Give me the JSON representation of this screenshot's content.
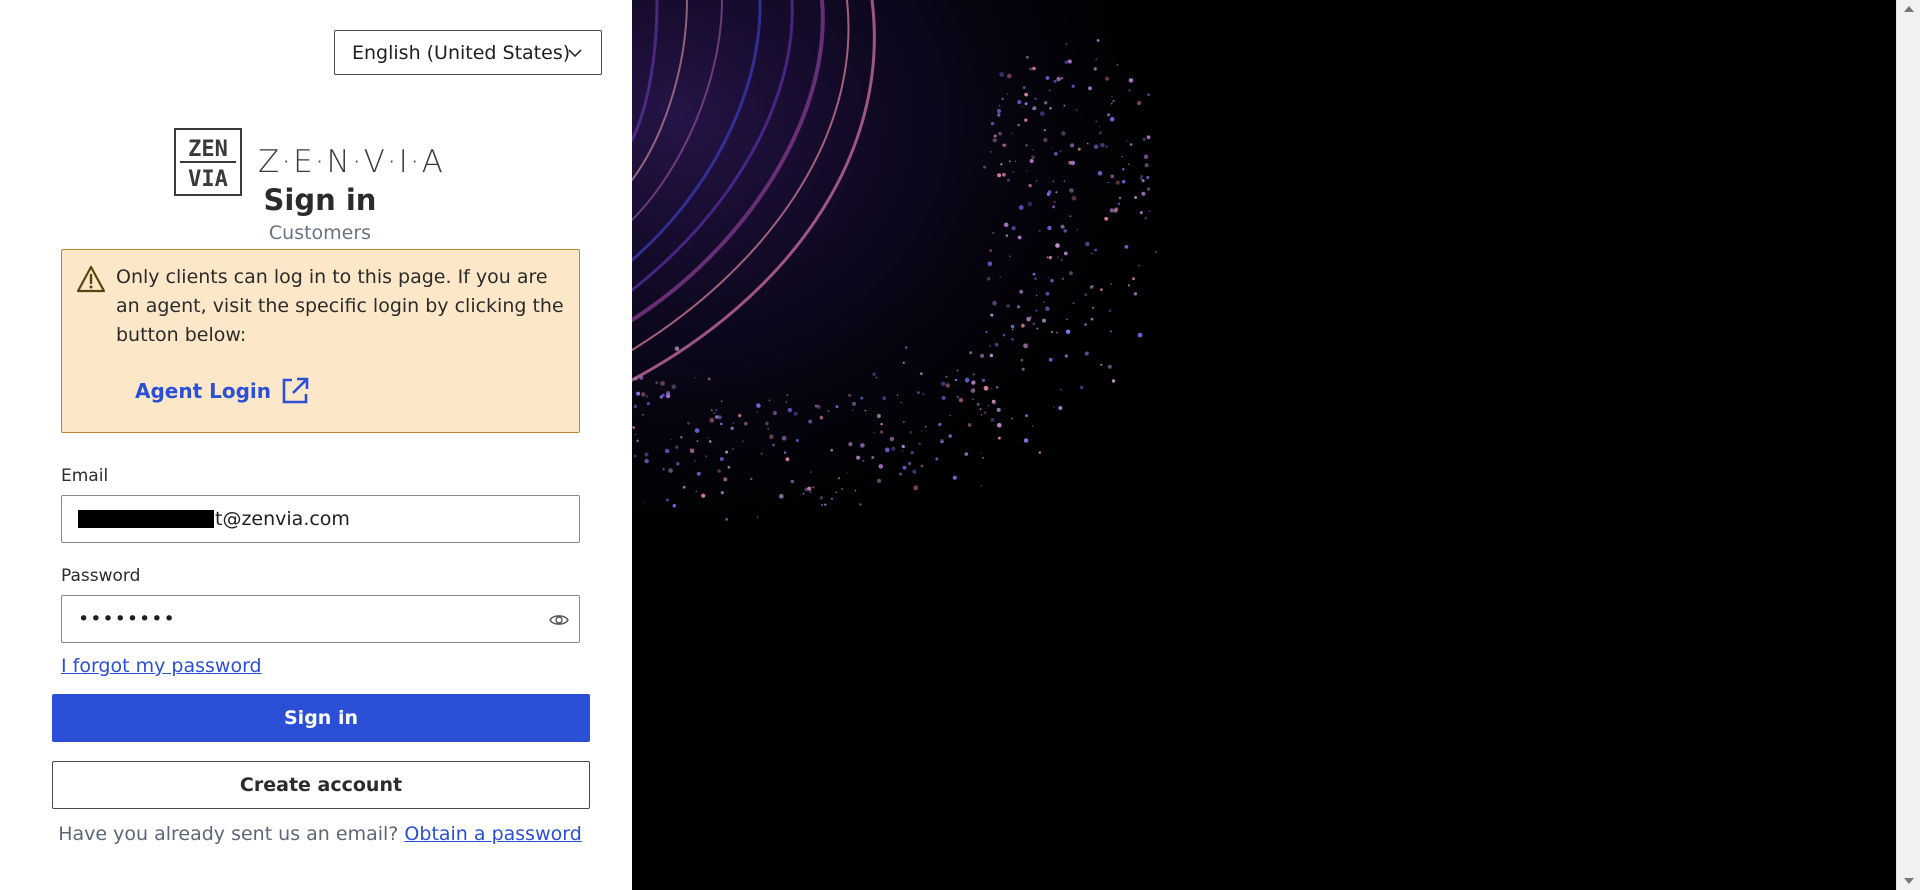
{
  "language": {
    "selected": "English (United States)"
  },
  "logo": {
    "wordmark": "Z·E·N·V·I·A",
    "mark_text_top": "ZEN",
    "mark_text_bottom": "VIA"
  },
  "heading": {
    "title": "Sign in",
    "subtitle": "Customers"
  },
  "alert": {
    "message": "Only clients can log in to this page. If you are an agent, visit the specific login by clicking the button below:",
    "link_label": "Agent Login"
  },
  "form": {
    "email_label": "Email",
    "email_value_visible": "t@zenvia.com",
    "password_label": "Password",
    "password_value": "••••••••",
    "forgot_label": "I forgot my password",
    "signin_label": "Sign in",
    "create_label": "Create account"
  },
  "footer": {
    "prompt": "Have you already sent us an email?",
    "link_label": "Obtain a password"
  },
  "colors": {
    "accent": "#2b4fd6",
    "alert_bg": "#fce8c9",
    "alert_border": "#b88a2f",
    "background_right": "#000000"
  }
}
